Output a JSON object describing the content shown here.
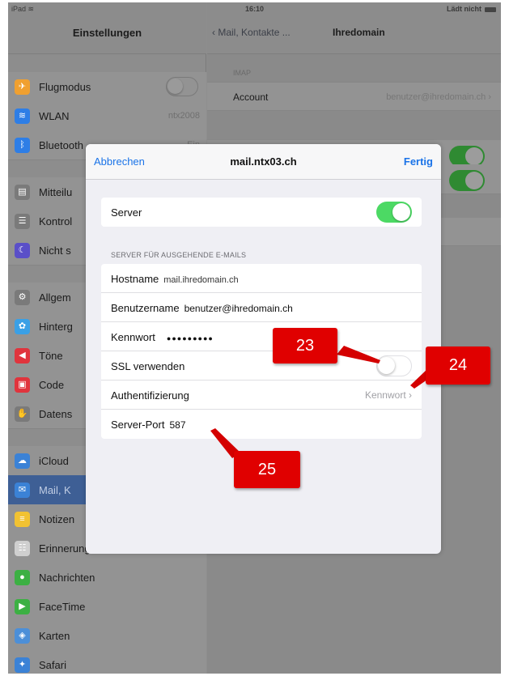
{
  "status_bar": {
    "device": "iPad",
    "time": "16:10",
    "battery_text": "Lädt nicht"
  },
  "sidebar": {
    "title": "Einstellungen",
    "items": [
      {
        "label": "Flugmodus",
        "icon": "airplane-icon",
        "color": "#f0a030",
        "control": "toggle-off"
      },
      {
        "label": "WLAN",
        "icon": "wifi-icon",
        "color": "#2e7ee6",
        "value": "ntx2008"
      },
      {
        "label": "Bluetooth",
        "icon": "bluetooth-icon",
        "color": "#2e7ee6",
        "value": "Ein"
      },
      {
        "label": "Mitteilu",
        "icon": "notifications-icon",
        "color": "#7a7a7a"
      },
      {
        "label": "Kontrol",
        "icon": "control-center-icon",
        "color": "#7a7a7a"
      },
      {
        "label": "Nicht s",
        "icon": "moon-icon",
        "color": "#5a4fc8"
      },
      {
        "label": "Allgem",
        "icon": "gear-icon",
        "color": "#7a7a7a"
      },
      {
        "label": "Hinterg",
        "icon": "wallpaper-icon",
        "color": "#3aa0e6"
      },
      {
        "label": "Töne",
        "icon": "speaker-icon",
        "color": "#e0343d"
      },
      {
        "label": "Code",
        "icon": "lock-icon",
        "color": "#e0343d"
      },
      {
        "label": "Datens",
        "icon": "hand-icon",
        "color": "#7a7a7a"
      },
      {
        "label": "iCloud",
        "icon": "cloud-icon",
        "color": "#3b82d6"
      },
      {
        "label": "Mail, K",
        "icon": "mail-icon",
        "color": "#3b82d6",
        "selected": true
      },
      {
        "label": "Notizen",
        "icon": "notes-icon",
        "color": "#f1c232"
      },
      {
        "label": "Erinnerungen",
        "icon": "list-icon",
        "color": "#cfcfcf"
      },
      {
        "label": "Nachrichten",
        "icon": "message-icon",
        "color": "#3cb043"
      },
      {
        "label": "FaceTime",
        "icon": "video-icon",
        "color": "#3cb043"
      },
      {
        "label": "Karten",
        "icon": "map-icon",
        "color": "#4c8fd8"
      },
      {
        "label": "Safari",
        "icon": "compass-icon",
        "color": "#3b82d6"
      }
    ]
  },
  "detail": {
    "back_label": "Mail, Kontakte ...",
    "title": "Ihredomain",
    "section_imap": "IMAP",
    "account_label": "Account",
    "account_value": "benutzer@ihredomain.ch"
  },
  "modal": {
    "cancel_label": "Abbrechen",
    "title": "mail.ntx03.ch",
    "done_label": "Fertig",
    "server_label": "Server",
    "section_header": "SERVER FÜR AUSGEHENDE E-MAILS",
    "hostname_label": "Hostname",
    "hostname_value": "mail.ihredomain.ch",
    "username_label": "Benutzername",
    "username_value": "benutzer@ihredomain.ch",
    "password_label": "Kennwort",
    "password_value": "●●●●●●●●●",
    "ssl_label": "SSL verwenden",
    "auth_label": "Authentifizierung",
    "auth_value": "Kennwort",
    "port_label": "Server-Port",
    "port_value": "587"
  },
  "callouts": [
    "23",
    "24",
    "25"
  ]
}
